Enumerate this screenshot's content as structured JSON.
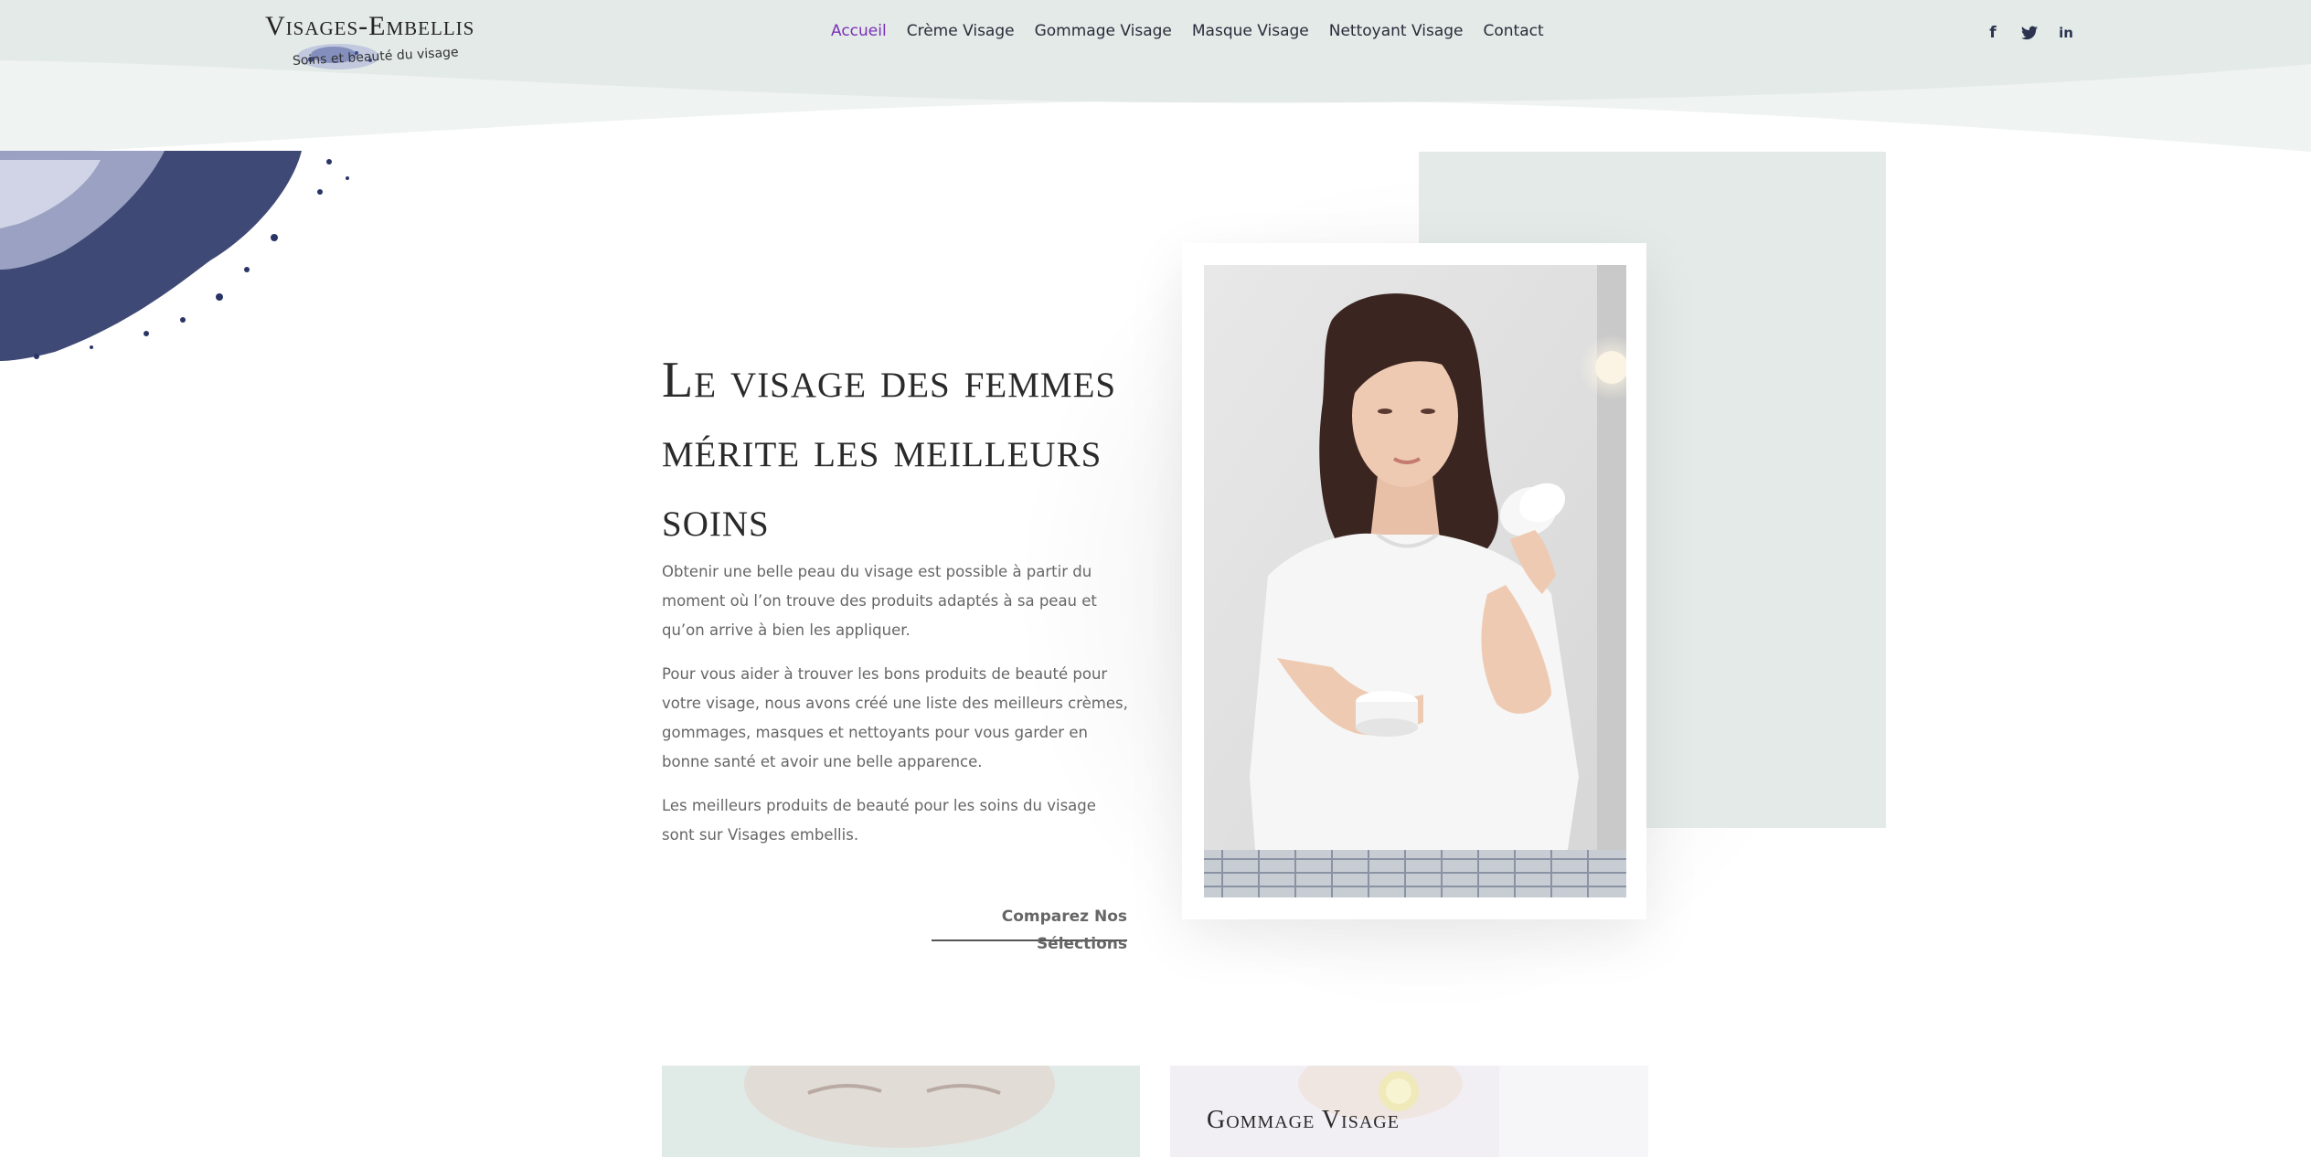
{
  "brand": {
    "title": "Visages-Embellis",
    "subtitle": "Soins et beauté du visage"
  },
  "nav": {
    "items": [
      {
        "label": "Accueil",
        "active": true
      },
      {
        "label": "Crème Visage",
        "active": false
      },
      {
        "label": "Gommage Visage",
        "active": false
      },
      {
        "label": "Masque Visage",
        "active": false
      },
      {
        "label": "Nettoyant Visage",
        "active": false
      },
      {
        "label": "Contact",
        "active": false
      }
    ]
  },
  "social": {
    "facebook": "f",
    "twitter": "t",
    "linkedin": "in"
  },
  "hero": {
    "title": "Le visage des femmes mérite les meilleurs soins",
    "paragraphs": [
      "Obtenir une belle peau du visage est possible à partir du moment où l’on trouve des produits adaptés à sa peau et qu’on arrive à bien les appliquer.",
      "Pour vous aider à trouver les bons produits de beauté pour votre visage, nous avons créé une liste des meilleurs crèmes, gommages, masques et nettoyants pour vous garder en bonne santé et avoir une belle apparence.",
      "Les meilleurs produits de beauté pour les soins du visage sont sur Visages embellis."
    ],
    "cta": "Comparez Nos Sélections"
  },
  "cards": [
    {
      "title": ""
    },
    {
      "title": "Gommage Visage"
    }
  ],
  "colors": {
    "header_bg": "#e3eae7",
    "accent": "#7a2fb8",
    "panel": "#e3eae7",
    "text": "#666666"
  }
}
